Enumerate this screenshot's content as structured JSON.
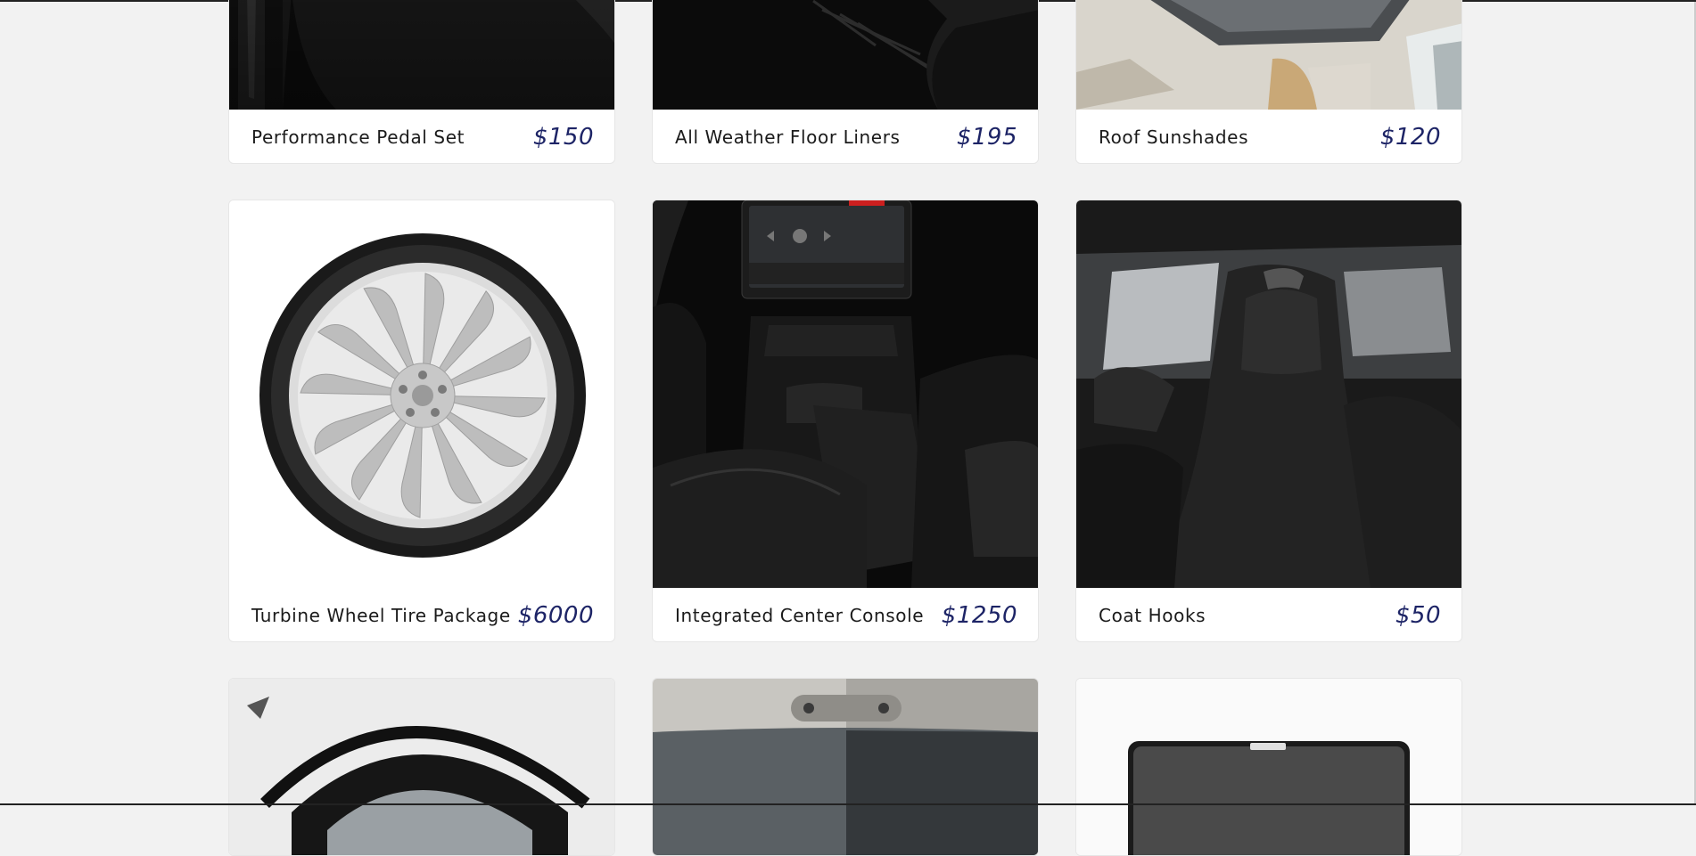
{
  "products": [
    {
      "name": "Performance Pedal Set",
      "price": "$150",
      "image": "pedal-set-image"
    },
    {
      "name": "All Weather Floor Liners",
      "price": "$195",
      "image": "floor-liners-image"
    },
    {
      "name": "Roof Sunshades",
      "price": "$120",
      "image": "roof-sunshades-image"
    },
    {
      "name": "Turbine Wheel Tire Package",
      "price": "$6000",
      "image": "turbine-wheel-image"
    },
    {
      "name": "Integrated Center Console",
      "price": "$1250",
      "image": "center-console-image"
    },
    {
      "name": "Coat Hooks",
      "price": "$50",
      "image": "coat-hooks-image"
    },
    {
      "name": "",
      "price": "",
      "image": "wheel-on-car-image"
    },
    {
      "name": "",
      "price": "",
      "image": "rear-window-image"
    },
    {
      "name": "",
      "price": "",
      "image": "window-shade-image"
    }
  ],
  "colors": {
    "page_bg": "#f2f2f2",
    "card_bg": "#ffffff",
    "price": "#1d2466",
    "name": "#1b1b1b"
  }
}
